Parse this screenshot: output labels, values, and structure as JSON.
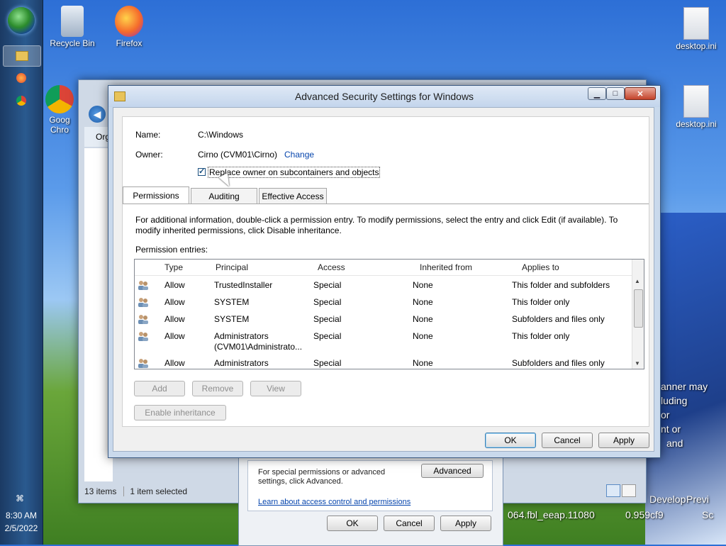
{
  "desktop": {
    "icons": [
      {
        "label": "Recycle Bin"
      },
      {
        "label": "Firefox"
      },
      {
        "label": "Goog Chro"
      },
      {
        "label": "desktop.ini"
      },
      {
        "label": "desktop.ini"
      }
    ],
    "watermark_fragments": [
      "anner may",
      "luding",
      "or",
      "nt or",
      "and",
      "Develop",
      "Previ",
      "064.fbl_eeap.11080",
      "0.959cf9",
      "Sc"
    ]
  },
  "taskbar": {
    "clock_time": "8:30 AM",
    "clock_date": "2/5/2022"
  },
  "background_explorer": {
    "status_items": "13 items",
    "status_selected": "1 item selected",
    "org_button": "Org"
  },
  "background_properties": {
    "info_text": "For special permissions or advanced settings, click Advanced.",
    "advanced_button": "Advanced",
    "learn_link": "Learn about access control and permissions",
    "ok": "OK",
    "cancel": "Cancel",
    "apply": "Apply"
  },
  "dialog": {
    "title": "Advanced Security Settings for Windows",
    "name_label": "Name:",
    "name_value": "C:\\Windows",
    "owner_label": "Owner:",
    "owner_value": "Cirno (CVM01\\Cirno)",
    "change_link": "Change",
    "replace_owner_checkbox": "Replace owner on subcontainers and objects",
    "replace_owner_checked": true,
    "tabs": [
      {
        "label": "Permissions",
        "active": true
      },
      {
        "label": "Auditing",
        "active": false
      },
      {
        "label": "Effective Access",
        "active": false
      }
    ],
    "info_text": "For additional information, double-click a permission entry. To modify permissions, select the entry and click Edit (if available). To modify inherited permissions, click Disable inheritance.",
    "entries_label": "Permission entries:",
    "columns": [
      "Type",
      "Principal",
      "Access",
      "Inherited from",
      "Applies to"
    ],
    "rows": [
      {
        "type": "Allow",
        "principal": "TrustedInstaller",
        "principal2": "",
        "access": "Special",
        "inherited": "None",
        "applies": "This folder and subfolders"
      },
      {
        "type": "Allow",
        "principal": "SYSTEM",
        "principal2": "",
        "access": "Special",
        "inherited": "None",
        "applies": "This folder only"
      },
      {
        "type": "Allow",
        "principal": "SYSTEM",
        "principal2": "",
        "access": "Special",
        "inherited": "None",
        "applies": "Subfolders and files only"
      },
      {
        "type": "Allow",
        "principal": "Administrators",
        "principal2": "(CVM01\\Administrato...",
        "access": "Special",
        "inherited": "None",
        "applies": "This folder only"
      },
      {
        "type": "Allow",
        "principal": "Administrators",
        "principal2": "",
        "access": "Special",
        "inherited": "None",
        "applies": "Subfolders and files only"
      }
    ],
    "add_button": "Add",
    "remove_button": "Remove",
    "view_button": "View",
    "enable_inheritance_button": "Enable inheritance",
    "ok_button": "OK",
    "cancel_button": "Cancel",
    "apply_button": "Apply"
  }
}
